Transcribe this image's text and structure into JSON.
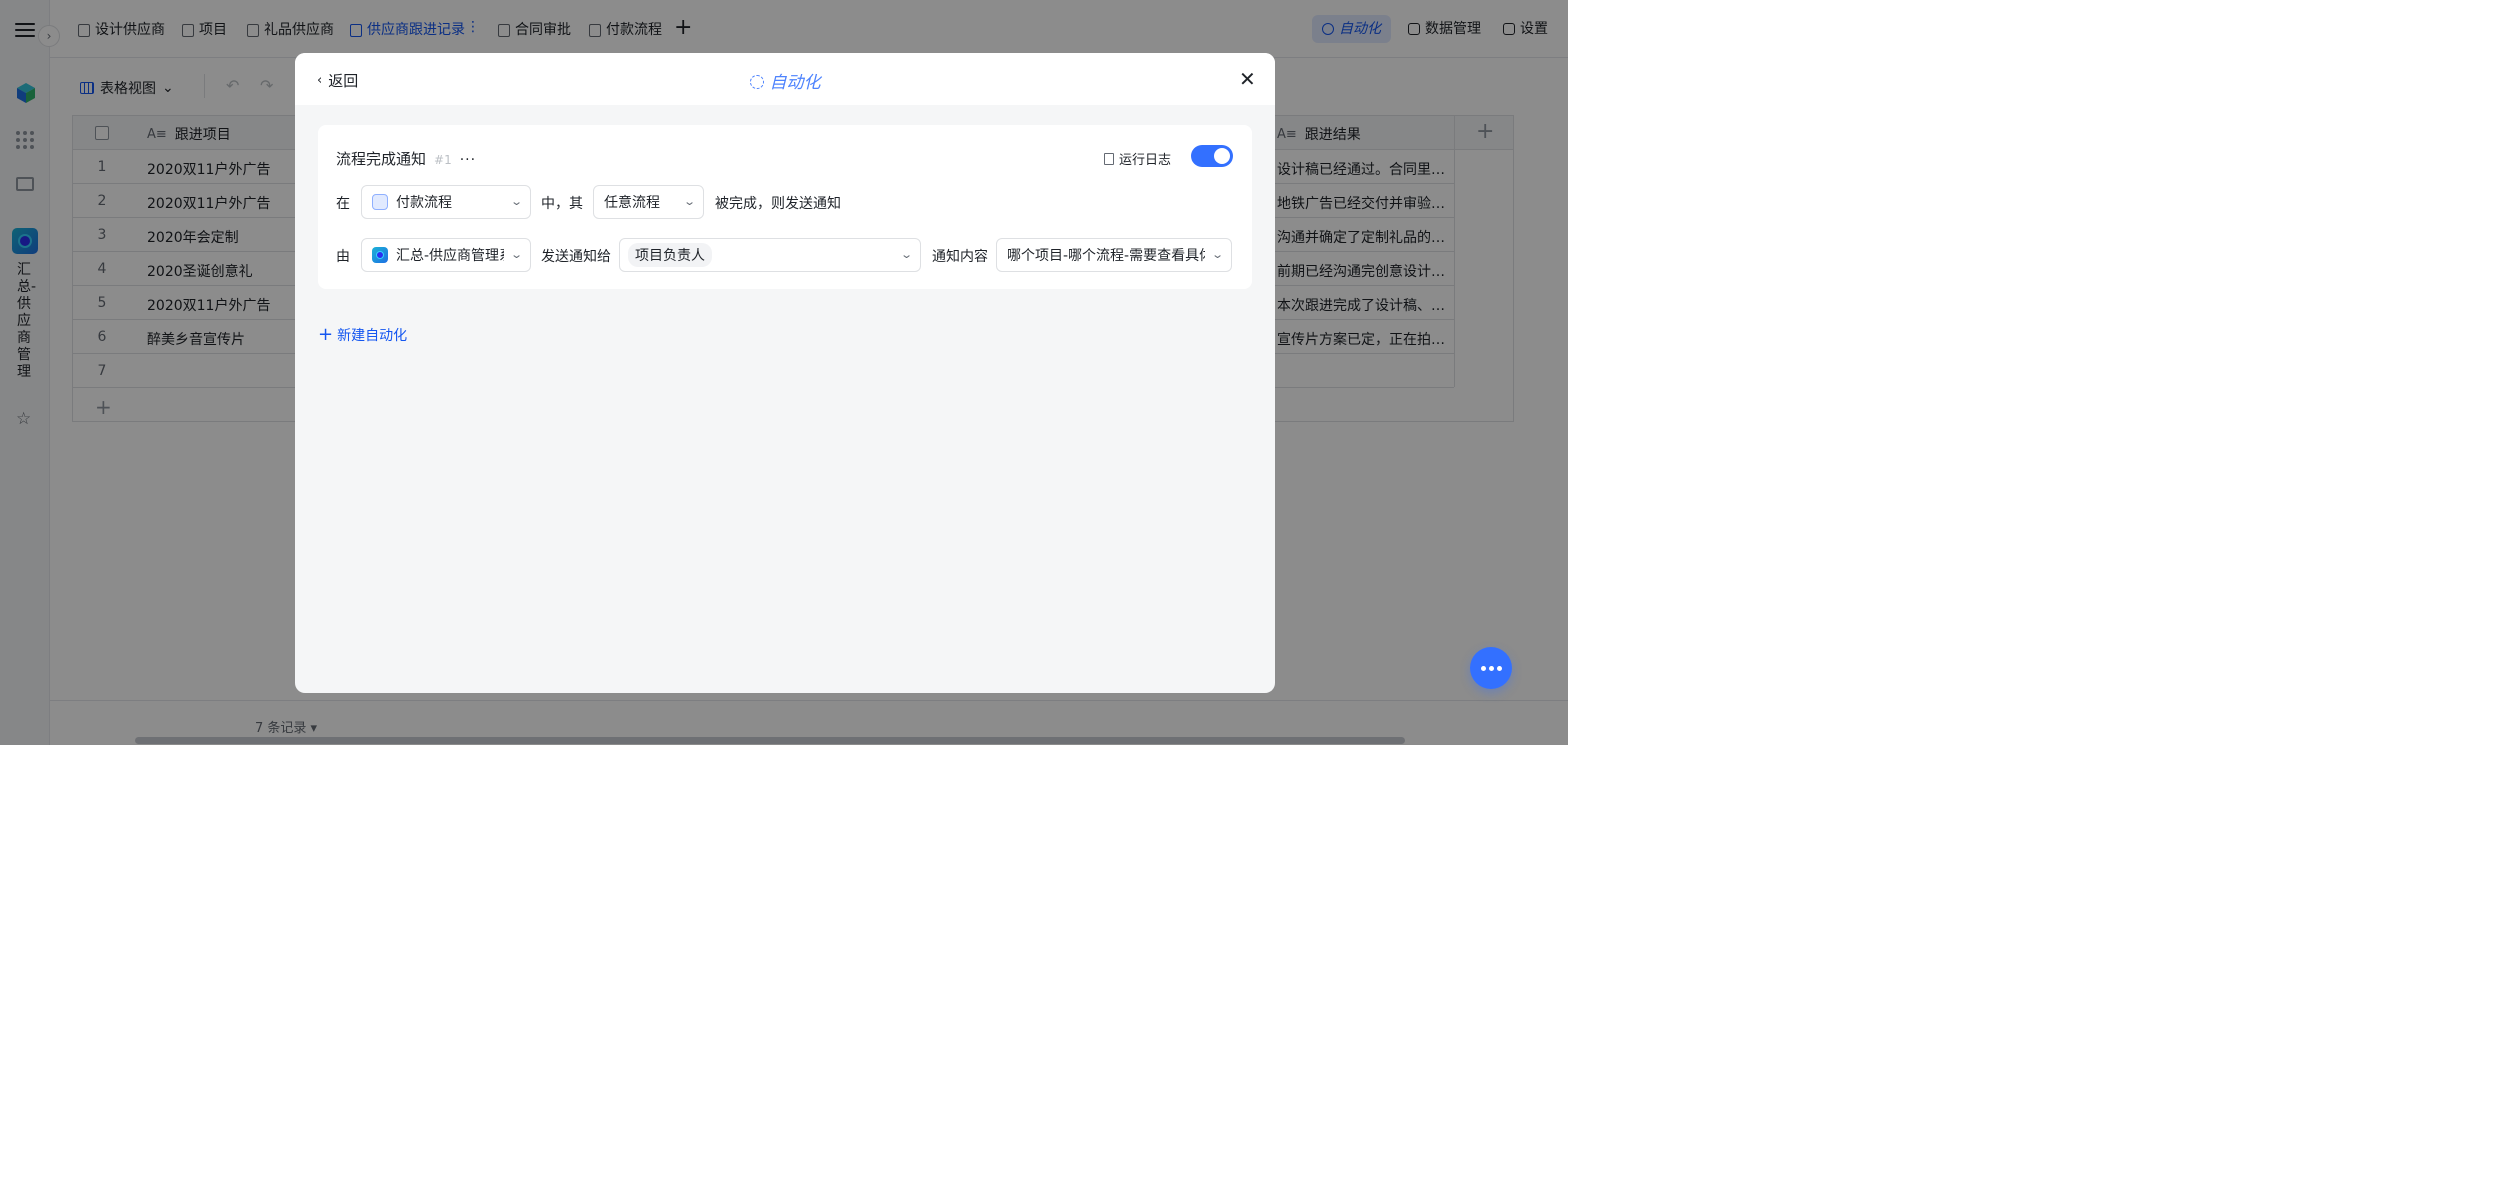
{
  "sidebar": {
    "app_name": "汇总-供应商管理"
  },
  "tabs": [
    {
      "label": "设计供应商",
      "active": false
    },
    {
      "label": "项目",
      "active": false
    },
    {
      "label": "礼品供应商",
      "active": false
    },
    {
      "label": "供应商跟进记录",
      "active": true
    },
    {
      "label": "合同审批",
      "active": false
    },
    {
      "label": "付款流程",
      "active": false
    }
  ],
  "top_right": {
    "automation": "自动化",
    "data_management": "数据管理",
    "settings": "设置"
  },
  "toolbar": {
    "view_label": "表格视图"
  },
  "table": {
    "columns": [
      "跟进项目",
      "跟进结果"
    ],
    "rows": [
      {
        "num": "1",
        "project": "2020双11户外广告",
        "result": "设计稿已经通过。合同里…"
      },
      {
        "num": "2",
        "project": "2020双11户外广告",
        "result": "地铁广告已经交付并审验…"
      },
      {
        "num": "3",
        "project": "2020年会定制",
        "result": "沟通并确定了定制礼品的…"
      },
      {
        "num": "4",
        "project": "2020圣诞创意礼",
        "result": "前期已经沟通完创意设计…"
      },
      {
        "num": "5",
        "project": "2020双11户外广告",
        "result": "本次跟进完成了设计稿、…"
      },
      {
        "num": "6",
        "project": "醉美乡音宣传片",
        "result": "宣传片方案已定，正在拍…"
      },
      {
        "num": "7",
        "project": "",
        "result": ""
      }
    ],
    "record_count": "7 条记录"
  },
  "modal": {
    "back_label": "返回",
    "title": "自动化",
    "rule": {
      "name": "流程完成通知",
      "number": "#1",
      "more": "···",
      "run_log": "运行日志",
      "enabled": true,
      "in_label": "在",
      "flow_select": "付款流程",
      "middle_label": "中，其",
      "any_flow_select": "任意流程",
      "completed_label": "被完成，则发送通知",
      "by_label": "由",
      "sender_select": "汇总-供应商管理系统",
      "send_to_label": "发送通知给",
      "recipient_chip": "项目负责人",
      "content_label": "通知内容",
      "content_select": "哪个项目-哪个流程-需要查看具体"
    },
    "new_automation": "新建自动化"
  }
}
